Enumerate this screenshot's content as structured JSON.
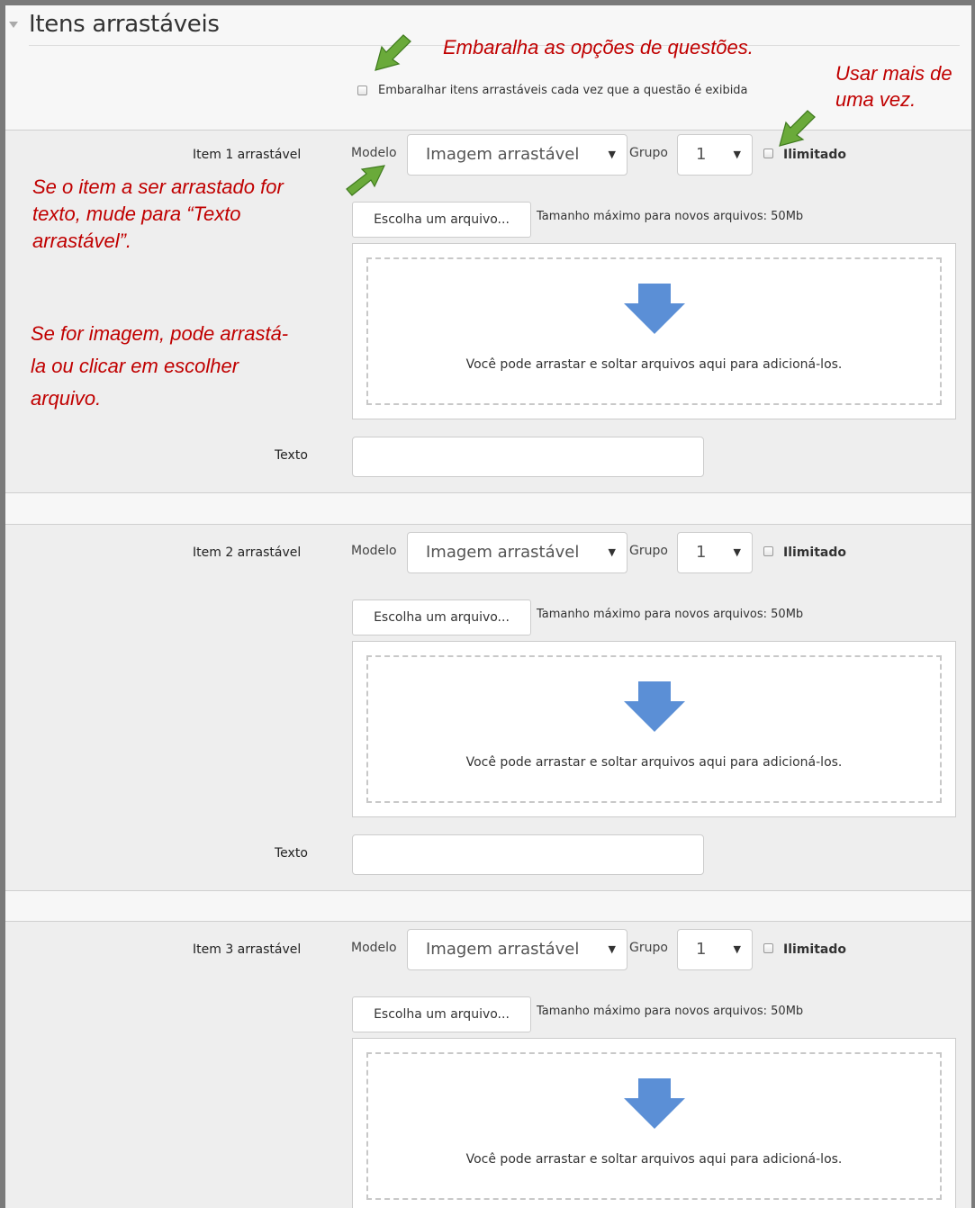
{
  "section": {
    "title": "Itens arrastáveis"
  },
  "shuffle": {
    "label": "Embaralhar itens arrastáveis cada vez que a questão é exibida"
  },
  "items": [
    {
      "label": "Item 1 arrastável",
      "modelo_label": "Modelo",
      "modelo_value": "Imagem arrastável",
      "grupo_label": "Grupo",
      "grupo_value": "1",
      "ilimitado": "Ilimitado",
      "file_button": "Escolha um arquivo...",
      "max_size": "Tamanho máximo para novos arquivos: 50Mb",
      "dropzone_text": "Você pode arrastar e soltar arquivos aqui para adicioná-los.",
      "texto_label": "Texto"
    },
    {
      "label": "Item 2 arrastável",
      "modelo_label": "Modelo",
      "modelo_value": "Imagem arrastável",
      "grupo_label": "Grupo",
      "grupo_value": "1",
      "ilimitado": "Ilimitado",
      "file_button": "Escolha um arquivo...",
      "max_size": "Tamanho máximo para novos arquivos: 50Mb",
      "dropzone_text": "Você pode arrastar e soltar arquivos aqui para adicioná-los.",
      "texto_label": "Texto"
    },
    {
      "label": "Item 3 arrastável",
      "modelo_label": "Modelo",
      "modelo_value": "Imagem arrastável",
      "grupo_label": "Grupo",
      "grupo_value": "1",
      "ilimitado": "Ilimitado",
      "file_button": "Escolha um arquivo...",
      "max_size": "Tamanho máximo para novos arquivos: 50Mb",
      "dropzone_text": "Você pode arrastar e soltar arquivos aqui para adicioná-los."
    }
  ],
  "annotations": {
    "shuffle_note": "Embaralha as opções de questões.",
    "reuse_note": [
      "Usar mais de",
      "uma vez."
    ],
    "text_note": [
      "Se o item a ser arrastado for",
      "texto, mude para “Texto",
      "arrastável”."
    ],
    "image_note": [
      "Se for imagem, pode arrastá-",
      "la ou clicar em escolher",
      "arquivo."
    ]
  },
  "colors": {
    "annotation": "#c00000",
    "arrow_green": "#6aaa3a",
    "drop_arrow": "#5b8fd6"
  },
  "icons": {
    "drag_annotation": "green-arrow-icon",
    "drop": "down-arrow-icon"
  }
}
